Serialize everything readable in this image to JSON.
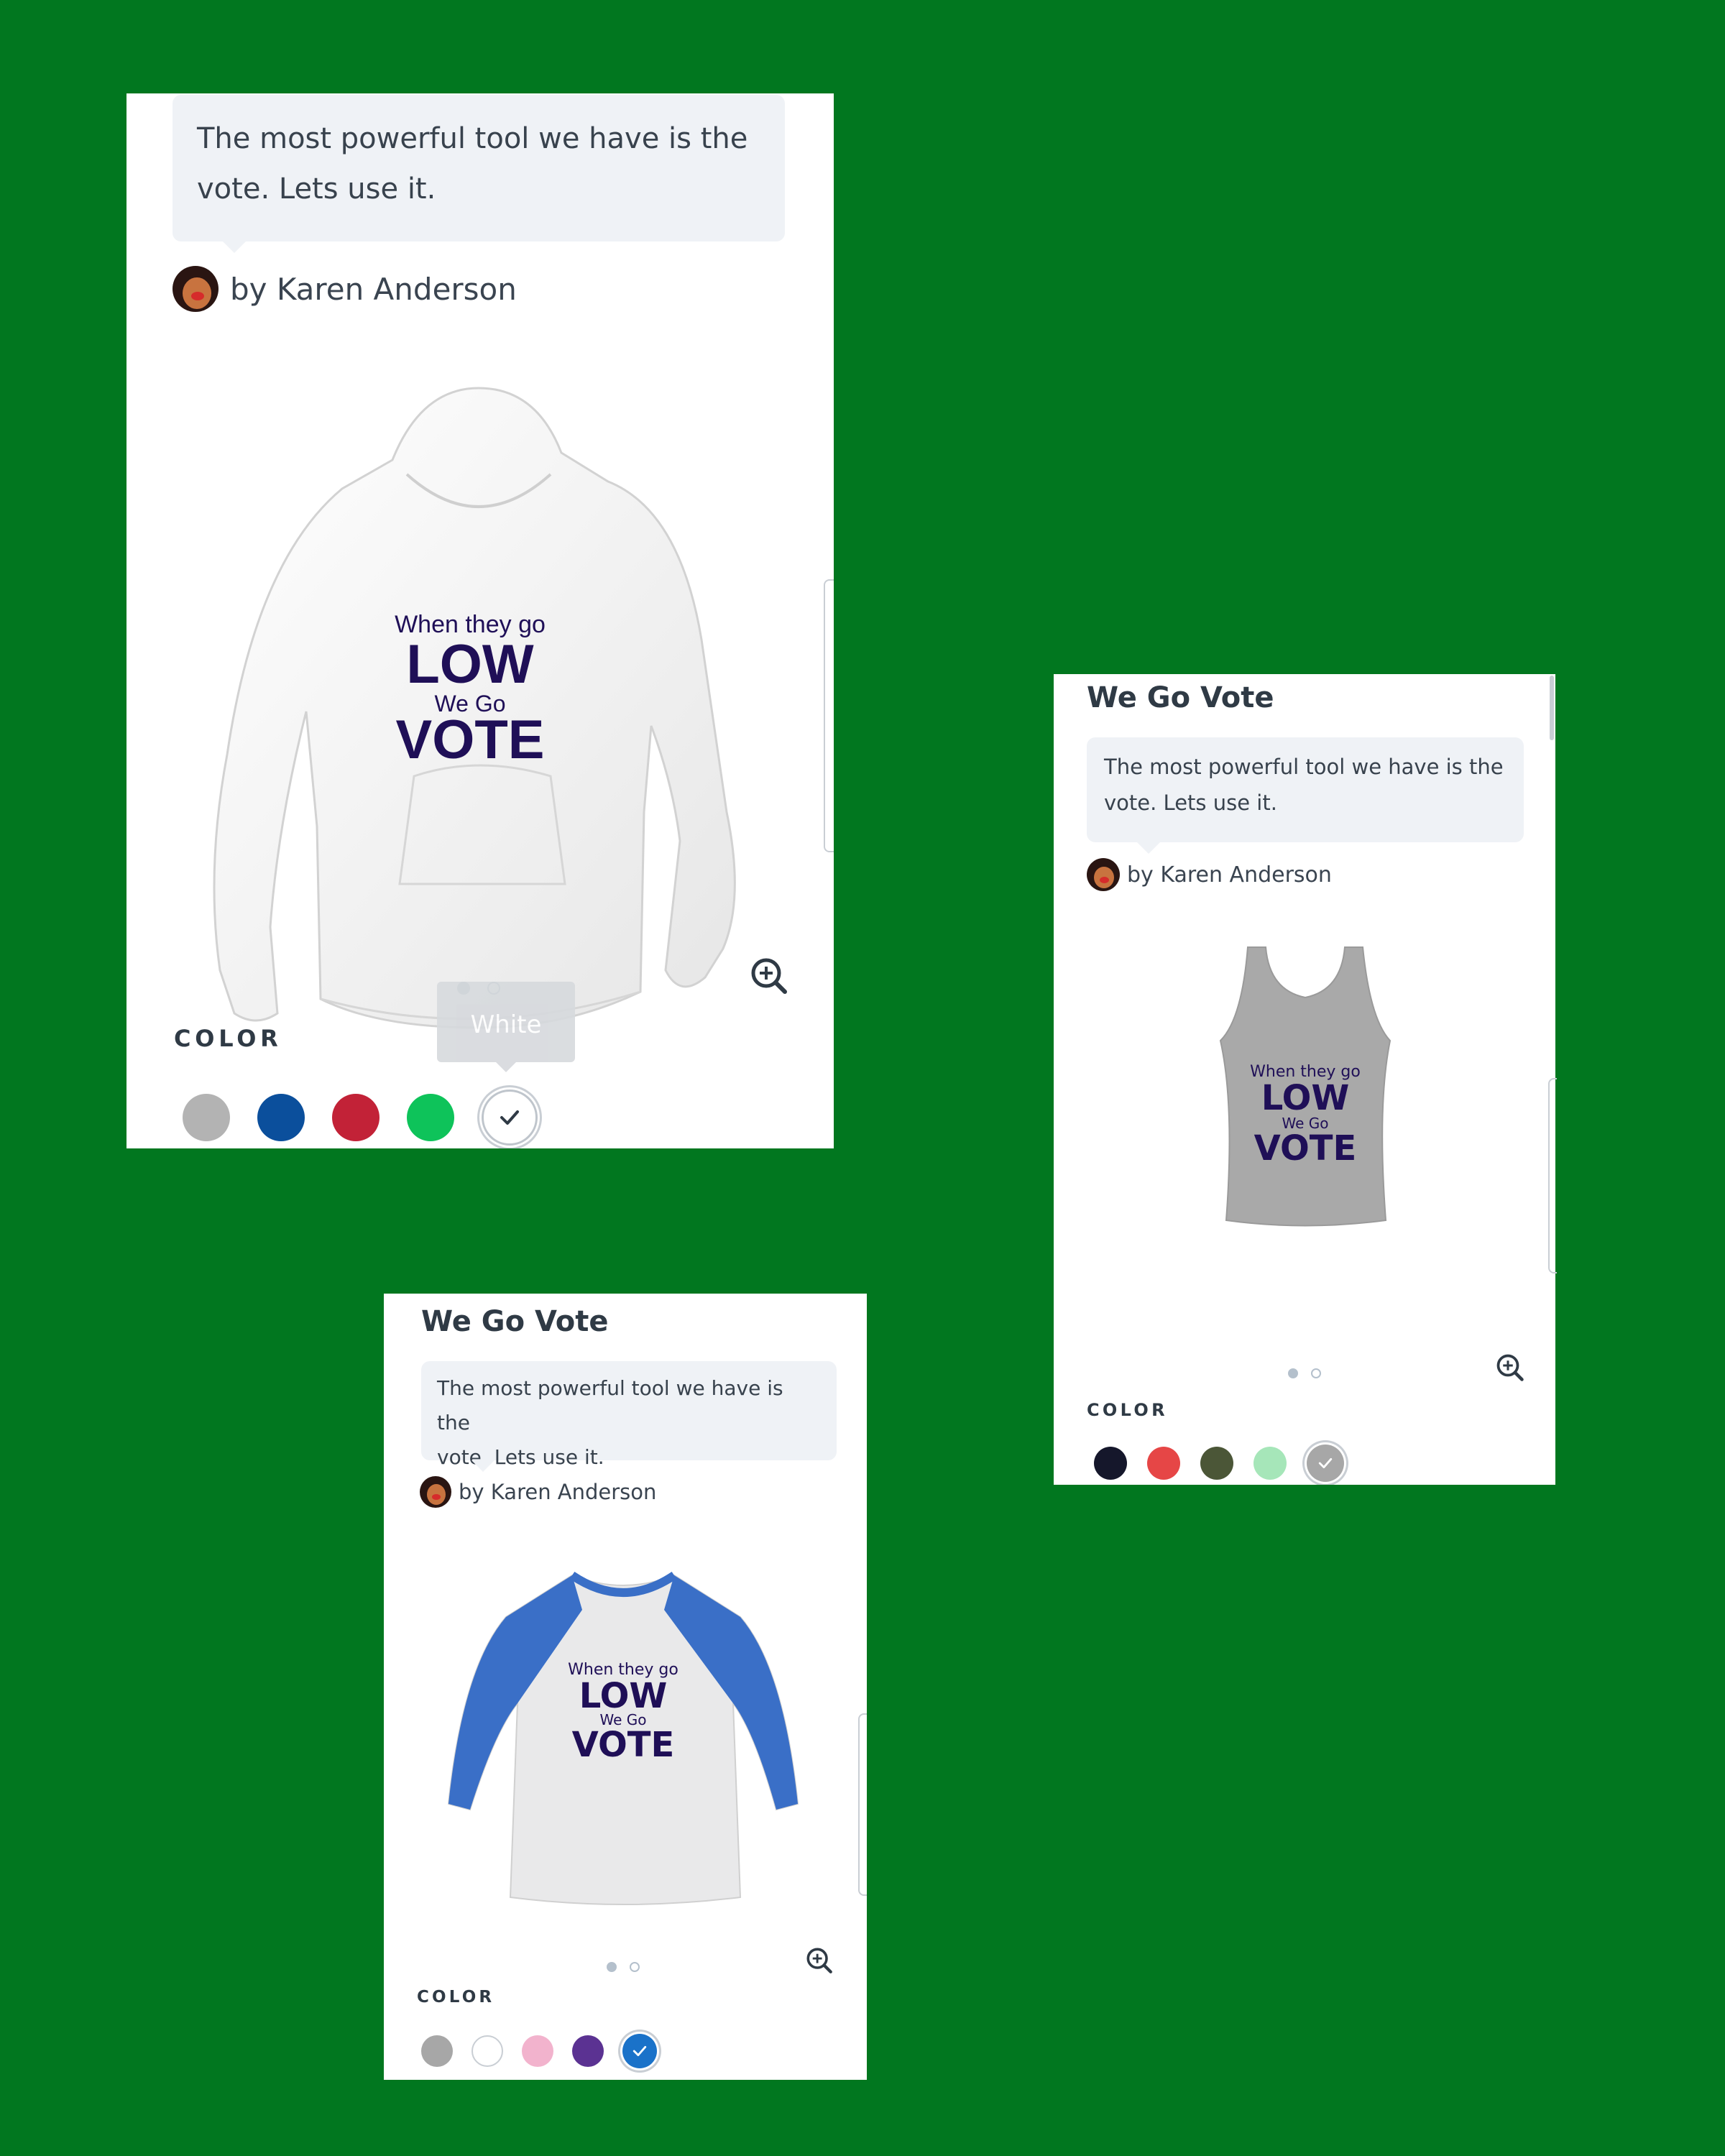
{
  "cards": [
    {
      "id": "hoodie",
      "title": "",
      "description": "The most powerful tool we have is the vote. Lets use it.",
      "description_lines": [
        "The most powerful tool we have is the",
        "vote. Lets use it."
      ],
      "byline": "by Karen Anderson",
      "design": {
        "line1": "When they go",
        "line2": "LOW",
        "line3": "We Go",
        "line4": "VOTE"
      },
      "color_label": "COLOR",
      "tooltip": "White",
      "swatches": [
        {
          "color": "#b3b3b3",
          "selected": false
        },
        {
          "color": "#0b4f9c",
          "selected": false
        },
        {
          "color": "#c22237",
          "selected": false
        },
        {
          "color": "#0ec35a",
          "selected": false
        },
        {
          "color": "#ffffff",
          "selected": true
        }
      ]
    },
    {
      "id": "tank",
      "title": "We Go Vote",
      "description_lines": [
        "The most powerful tool we have is the",
        "vote. Lets use it."
      ],
      "byline": "by Karen Anderson",
      "design": {
        "line1": "When they go",
        "line2": "LOW",
        "line3": "We Go",
        "line4": "VOTE"
      },
      "color_label": "COLOR",
      "swatches": [
        {
          "color": "#15172b",
          "selected": false
        },
        {
          "color": "#e64646",
          "selected": false
        },
        {
          "color": "#4b5637",
          "selected": false
        },
        {
          "color": "#a6e6b9",
          "selected": false
        },
        {
          "color": "#a7a7a7",
          "selected": true
        }
      ]
    },
    {
      "id": "raglan",
      "title": "We Go Vote",
      "description_lines": [
        "The most powerful tool we have is the",
        "vote. Lets use it."
      ],
      "byline": "by Karen Anderson",
      "design": {
        "line1": "When they go",
        "line2": "LOW",
        "line3": "We Go",
        "line4": "VOTE"
      },
      "color_label": "COLOR",
      "swatches": [
        {
          "color": "#a7a7a7",
          "selected": false
        },
        {
          "color": "#ffffff",
          "selected": false
        },
        {
          "color": "#f2b3cd",
          "selected": false
        },
        {
          "color": "#5b3292",
          "selected": false
        },
        {
          "color": "#1a72c9",
          "selected": true
        }
      ]
    }
  ],
  "icons": {
    "zoom": "zoom-in-icon",
    "check": "check-icon",
    "avatar": "avatar"
  }
}
